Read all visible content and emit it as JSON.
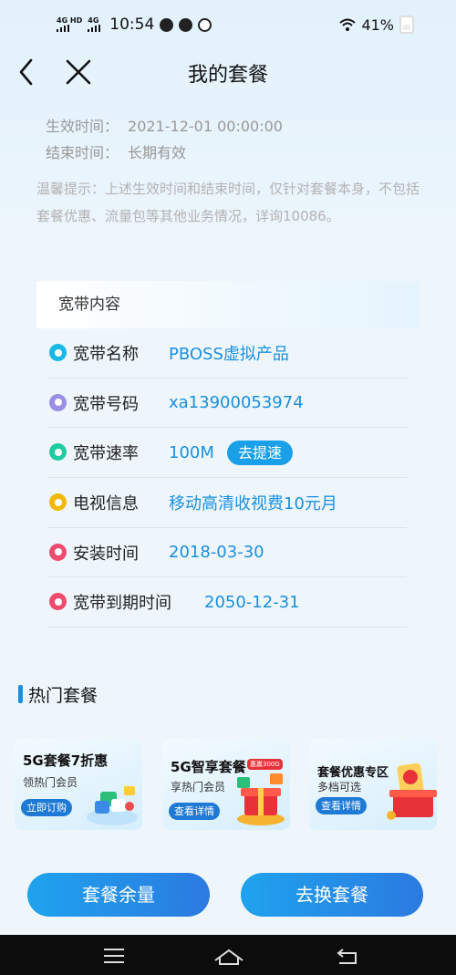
{
  "status_bar": {
    "signal_left": "4G HD",
    "signal_right": "4G",
    "time": "10:54",
    "icons": [
      "chat-bubble-icon",
      "wechat-icon",
      "app-icon"
    ],
    "battery": "41%"
  },
  "header": {
    "title": "我的套餐"
  },
  "validity": {
    "start_label": "生效时间：",
    "start_value": "2021-12-01 00:00:00",
    "end_label": "结束时间：",
    "end_value": "长期有效"
  },
  "notice": "温馨提示：上述生效时间和结束时间，仅针对套餐本身，不包括套餐优惠、流量包等其他业务情况，详询10086。",
  "broadband": {
    "section_title": "宽带内容",
    "rows": [
      {
        "label": "宽带名称",
        "value": "PBOSS虚拟产品",
        "dot_color": "#19b8e5"
      },
      {
        "label": "宽带号码",
        "value": "xa13900053974",
        "dot_color": "#9a8fe6"
      },
      {
        "label": "宽带速率",
        "value": "100M",
        "dot_color": "#1fcc9f"
      },
      {
        "label": "电视信息",
        "value": "移动高清收视费10元月",
        "dot_color": "#f2b807"
      },
      {
        "label": "安装时间",
        "value": "2018-03-30",
        "dot_color": "#f04a6f"
      },
      {
        "label": "宽带到期时间",
        "value": "2050-12-31",
        "dot_color": "#f04a6f"
      }
    ],
    "speed_button": "去提速"
  },
  "hot": {
    "title": "热门套餐",
    "cards": [
      {
        "title": "5G套餐7折惠",
        "subtitle": "领热门会员",
        "button": "立即订购"
      },
      {
        "title": "5G智享套餐",
        "subtitle": "享热门会员",
        "button": "查看详情",
        "badge": "惠赢300G"
      },
      {
        "title": "套餐优惠专区",
        "subtitle": "多档可选",
        "button": "查看详情"
      }
    ]
  },
  "actions": {
    "balance": "套餐余量",
    "change": "去换套餐"
  },
  "colors": {
    "accent": "#1a8fe0",
    "button": "#1fa3ee"
  }
}
